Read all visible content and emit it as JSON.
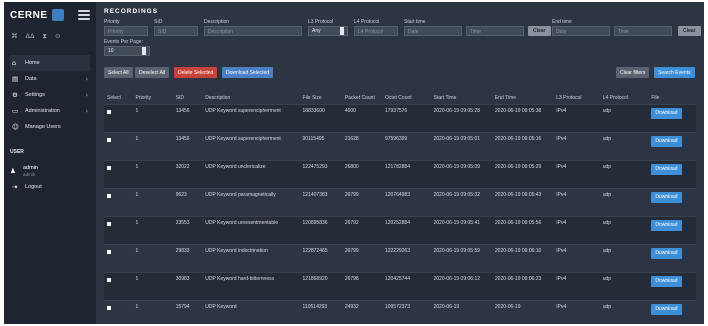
{
  "app": {
    "brand": "CERNE",
    "sidebar_icons": [
      "⌘",
      "ΔΔ",
      "⧗",
      "⊙"
    ],
    "nav": [
      {
        "label": "Home",
        "icon": "home-icon",
        "glyph": "⌂",
        "chevron": ""
      },
      {
        "label": "Data",
        "icon": "chart-icon",
        "glyph": "▤",
        "chevron": "›"
      },
      {
        "label": "Settings",
        "icon": "gear-icon",
        "glyph": "⚙",
        "chevron": "›"
      },
      {
        "label": "Administration",
        "icon": "monitor-icon",
        "glyph": "▭",
        "chevron": "›"
      },
      {
        "label": "Manage Users",
        "icon": "users-icon",
        "glyph": "☺",
        "chevron": ""
      }
    ],
    "user_section": "USER",
    "user": {
      "name": "admin",
      "role": "admin"
    },
    "logout": "Logout"
  },
  "page": {
    "title": "RECORDINGS"
  },
  "filters": {
    "priority": {
      "label": "Priority",
      "placeholder": "Priority"
    },
    "sid": {
      "label": "SID",
      "placeholder": "SID"
    },
    "description": {
      "label": "Description",
      "placeholder": "Description"
    },
    "l3_protocol": {
      "label": "L3 Protocol",
      "value": "Any"
    },
    "l4_protocol": {
      "label": "L4 Protocol",
      "placeholder": "L4 Protocol"
    },
    "start_time": {
      "label": "Start time",
      "date": "Date",
      "time": "Time"
    },
    "end_time": {
      "label": "End time",
      "date": "Date",
      "time": "Time"
    },
    "clear1": "Clear",
    "clear2": "Clear",
    "events_per_page": {
      "label": "Events Per Page:",
      "value": "10"
    }
  },
  "actions": {
    "select_all": "Select All",
    "deselect_all": "Deselect All",
    "delete_selected": "Delete Selected",
    "download_selected": "Download Selected",
    "clear_filters": "Clear filters",
    "search_events": "Search Events"
  },
  "table": {
    "headers": [
      "Select",
      "Priority",
      "SID",
      "Description",
      "File Size",
      "Packet Count",
      "Octet Count",
      "Start Time",
      "End Time",
      "L3 Protocol",
      "L4 Protocol",
      "File"
    ],
    "download_label": "Download",
    "rows": [
      {
        "priority": "1",
        "sid": "13456",
        "desc": "UDP Keyword superencipherment",
        "size": "18833600",
        "packets": "4000",
        "octets": "17937576",
        "start": "2020-06-19 09:05:28",
        "end": "2020-06-19 09:05:38",
        "l3": "IPv4",
        "l4": "udp"
      },
      {
        "priority": "1",
        "sid": "13456",
        "desc": "UDP Keyword superencipherment",
        "size": "90115495",
        "packets": "21628",
        "octets": "97596399",
        "start": "2020-06-19 09:05:01",
        "end": "2020-06-19 09:05:16",
        "l3": "IPv4",
        "l4": "udp"
      },
      {
        "priority": "1",
        "sid": "32022",
        "desc": "UDP Keyword unclericalize",
        "size": "122475293",
        "packets": "26800",
        "octets": "121782884",
        "start": "2020-06-19 09:05:09",
        "end": "2020-06-19 09:05:29",
        "l3": "IPv4",
        "l4": "udp"
      },
      {
        "priority": "1",
        "sid": "9623",
        "desc": "UDP Keyword paramagnetically",
        "size": "121407383",
        "packets": "26799",
        "octets": "120764983",
        "start": "2020-06-19 09:05:32",
        "end": "2020-06-19 09:05:43",
        "l3": "IPv4",
        "l4": "udp"
      },
      {
        "priority": "1",
        "sid": "23553",
        "desc": "UDP Keyword unresentmentable",
        "size": "120895836",
        "packets": "26792",
        "octets": "120252884",
        "start": "2020-06-19 09:05:41",
        "end": "2020-06-19 09:05:56",
        "l3": "IPv4",
        "l4": "udp"
      },
      {
        "priority": "1",
        "sid": "29833",
        "desc": "UDP Keyword indoctrination",
        "size": "122872465",
        "packets": "26799",
        "octets": "122229263",
        "start": "2020-06-19 09:05:59",
        "end": "2020-06-19 09:06:10",
        "l3": "IPv4",
        "l4": "udp"
      },
      {
        "priority": "1",
        "sid": "30983",
        "desc": "UDP Keyword hard-bitternness",
        "size": "121868920",
        "packets": "26798",
        "octets": "120425744",
        "start": "2020-06-19 09:06:12",
        "end": "2020-06-19 09:06:23",
        "l3": "IPv4",
        "l4": "udp"
      },
      {
        "priority": "1",
        "sid": "15794",
        "desc": "UDP Keyword",
        "size": "110514293",
        "packets": "24932",
        "octets": "109572373",
        "start": "2020-06-19",
        "end": "2020-06-19",
        "l3": "IPv4",
        "l4": "udp"
      }
    ]
  }
}
